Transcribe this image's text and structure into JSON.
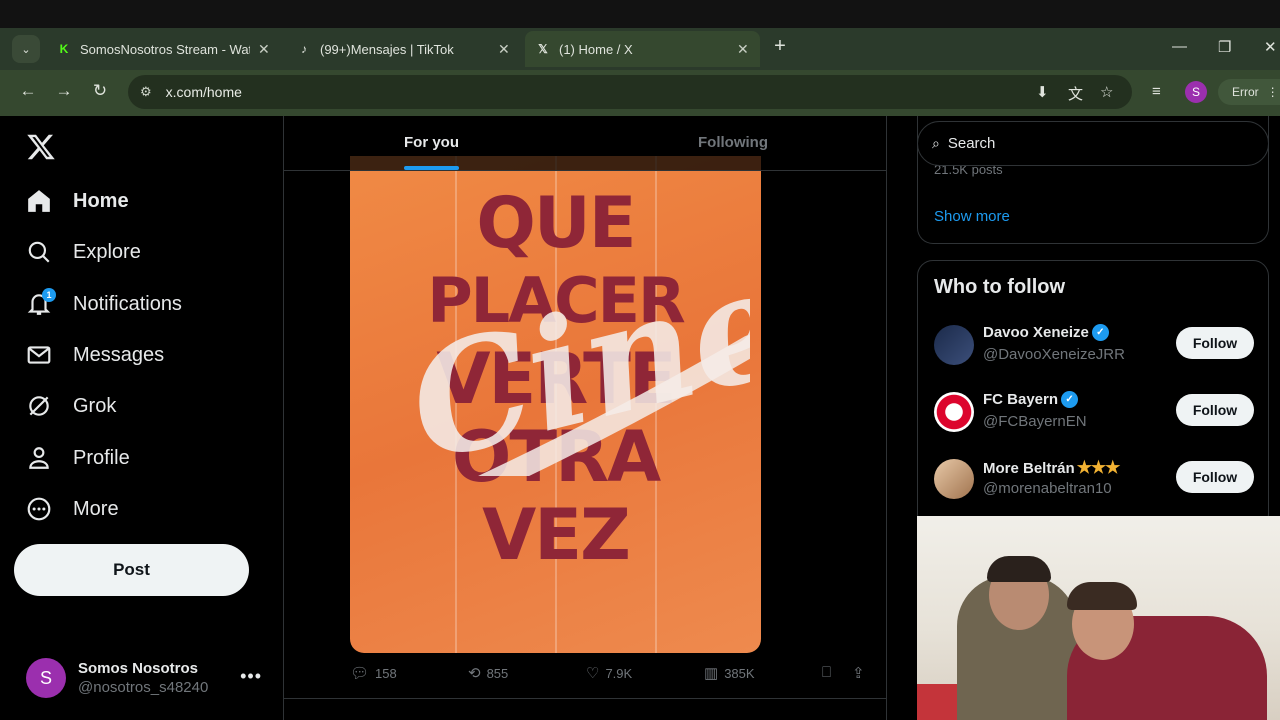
{
  "browser": {
    "tabs": [
      {
        "title": "SomosNosotros Stream - Watch",
        "favicon": "kick-icon",
        "color": "#53fc18"
      },
      {
        "title": "(99+)Mensajes | TikTok",
        "favicon": "tiktok-icon",
        "color": "#ffffff"
      },
      {
        "title": "(1) Home / X",
        "favicon": "x-icon",
        "color": "#ffffff"
      }
    ],
    "url": "x.com/home",
    "error_label": "Error",
    "profile_initial": "S"
  },
  "sidebar": {
    "items": [
      {
        "label": "Home",
        "icon": "home-icon"
      },
      {
        "label": "Explore",
        "icon": "search-icon"
      },
      {
        "label": "Notifications",
        "icon": "bell-icon",
        "badge": "1"
      },
      {
        "label": "Messages",
        "icon": "mail-icon"
      },
      {
        "label": "Grok",
        "icon": "grok-icon"
      },
      {
        "label": "Profile",
        "icon": "person-icon"
      },
      {
        "label": "More",
        "icon": "more-circle-icon"
      }
    ],
    "post_label": "Post",
    "account": {
      "name": "Somos Nosotros",
      "handle": "@nosotros_s48240",
      "initial": "S"
    }
  },
  "feed": {
    "tabs": [
      {
        "label": "For you"
      },
      {
        "label": "Following"
      }
    ],
    "post": {
      "poster_lines": [
        "QUE",
        "PLACER",
        "VERTE",
        "OTRA",
        "VEZ"
      ],
      "scrawl": "Cine",
      "replies": "158",
      "reposts": "855",
      "likes": "7.9K",
      "views": "385K"
    }
  },
  "right": {
    "search_placeholder": "Search",
    "trend_cut_text": "21.5K posts",
    "show_more": "Show more",
    "who_to_follow": {
      "title": "Who to follow",
      "items": [
        {
          "name": "Davoo Xeneize",
          "handle": "@DavooXeneizeJRR",
          "verified": true,
          "button": "Follow"
        },
        {
          "name": "FC Bayern",
          "handle": "@FCBayernEN",
          "verified": true,
          "button": "Follow"
        },
        {
          "name": "More Beltrán",
          "handle": "@morenabeltran10",
          "stars": "★★★",
          "button": "Follow"
        }
      ]
    }
  },
  "colors": {
    "accent": "#1d9bf0",
    "poster_bg": "#ee8142",
    "poster_text": "#8f2637"
  }
}
